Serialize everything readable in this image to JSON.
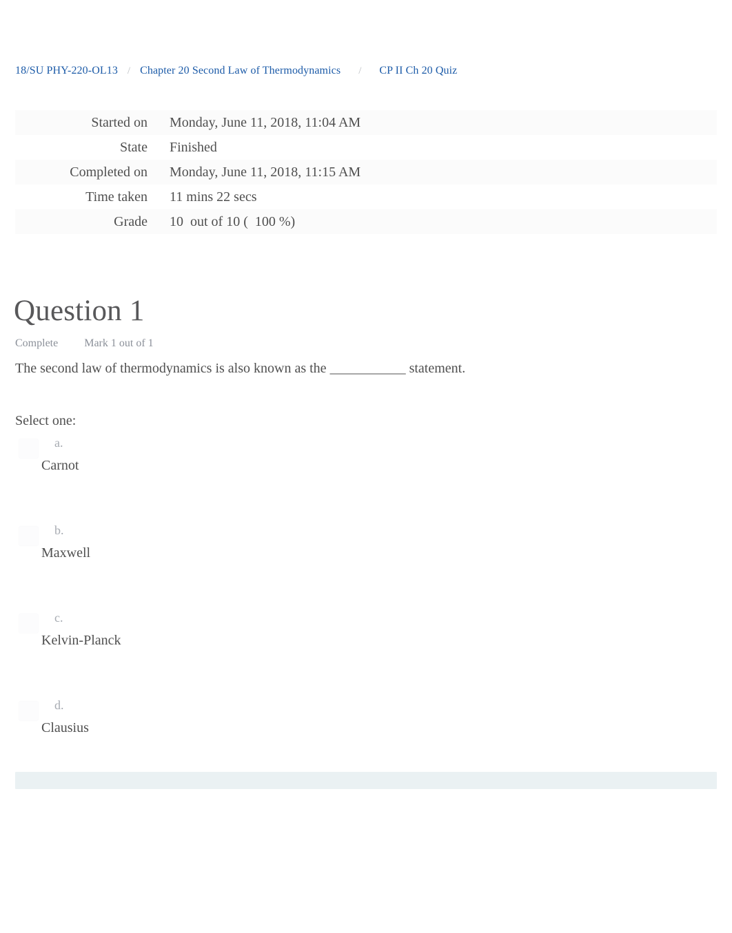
{
  "breadcrumb": {
    "separator": "/",
    "items": [
      {
        "label": "18/SU PHY-220-OL13"
      },
      {
        "label": "Chapter 20 Second Law of Thermodynamics"
      },
      {
        "label": "CP II Ch 20 Quiz"
      }
    ]
  },
  "summary": {
    "rows": [
      {
        "key": "Started on",
        "value": "Monday, June 11, 2018, 11:04 AM"
      },
      {
        "key": "State",
        "value": "Finished"
      },
      {
        "key": "Completed on",
        "value": "Monday, June 11, 2018, 11:15 AM"
      },
      {
        "key": "Time taken",
        "value": "11 mins 22 secs"
      },
      {
        "key": "Grade",
        "value": "10  out of 10 (  100 %)"
      }
    ]
  },
  "question": {
    "title": "Question 1",
    "state": "Complete",
    "mark": "Mark 1 out of 1",
    "text": "The second law of thermodynamics is also known as the ___________ statement.",
    "select_prompt": "Select one:",
    "options": [
      {
        "letter": "a.",
        "label": "Carnot"
      },
      {
        "letter": "b.",
        "label": "Maxwell"
      },
      {
        "letter": "c.",
        "label": "Kelvin-Planck"
      },
      {
        "letter": "d.",
        "label": "Clausius"
      }
    ]
  },
  "colors": {
    "link": "#1c5ba8",
    "text": "#4f4f4f",
    "muted": "#8b9099",
    "letter": "#a7abb2",
    "bottom_bar": "#eaf1f3",
    "row_stripe": "#fbfbfb"
  }
}
